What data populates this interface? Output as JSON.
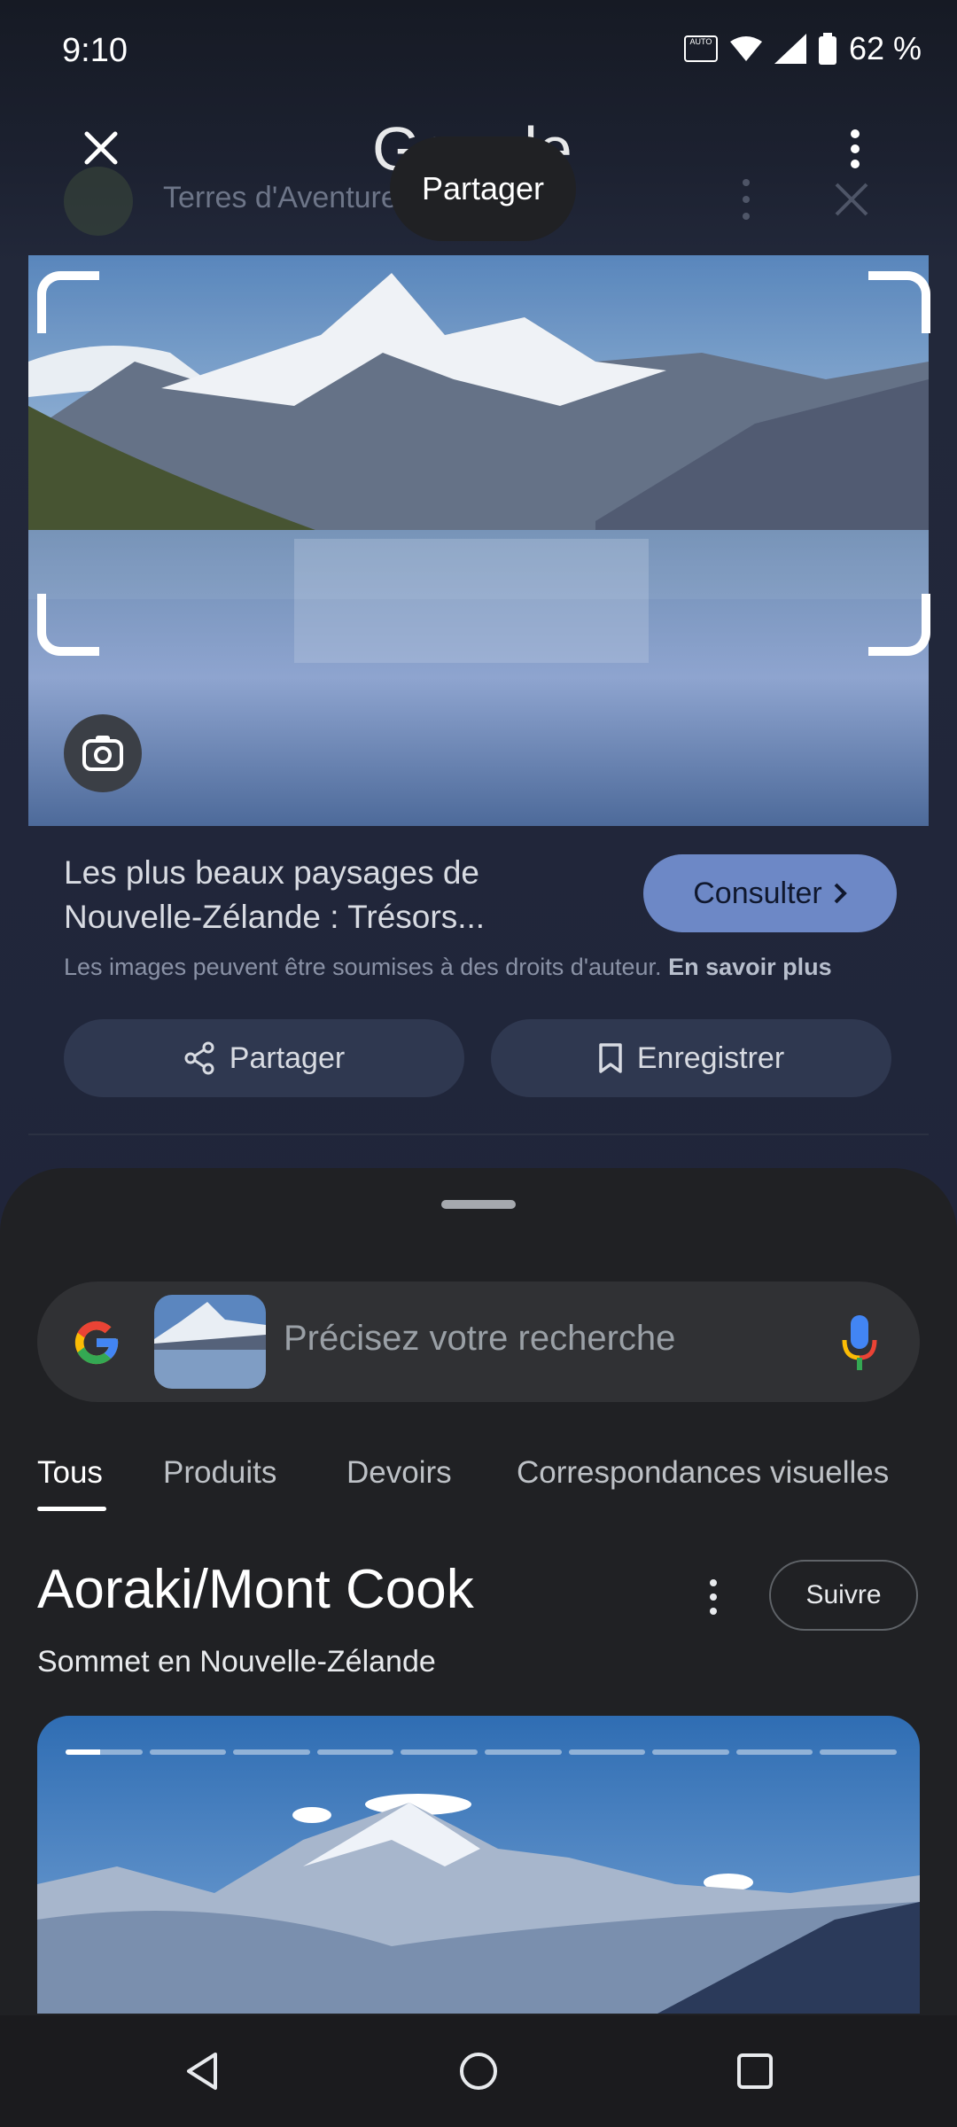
{
  "status_bar": {
    "time": "9:10",
    "auto_badge": "AUTO",
    "battery": "62 %"
  },
  "top_bar": {
    "logo_text": "Google"
  },
  "source": {
    "site_name": "Terres d'Aventure"
  },
  "tooltip": {
    "text": "Partager"
  },
  "result": {
    "title_line1": "Les plus beaux paysages de",
    "title_line2": "Nouvelle-Zélande : Trésors...",
    "consult_label": "Consulter",
    "copyright_text": "Les images peuvent être soumises à des droits d'auteur.",
    "learn_more": "En savoir plus",
    "share_label": "Partager",
    "save_label": "Enregistrer"
  },
  "search": {
    "placeholder": "Précisez votre recherche"
  },
  "tabs": [
    {
      "label": "Tous",
      "active": true
    },
    {
      "label": "Produits",
      "active": false
    },
    {
      "label": "Devoirs",
      "active": false
    },
    {
      "label": "Correspondances visuelles",
      "active": false
    }
  ],
  "knowledge_panel": {
    "title": "Aoraki/Mont Cook",
    "subtitle": "Sommet en Nouvelle-Zélande",
    "follow_label": "Suivre",
    "story_segments": 10,
    "story_progress_first_segment": 0.45
  },
  "colors": {
    "accent_button": "#6d88c6",
    "sheet_background": "#202124",
    "google_blue": "#4285F4",
    "google_red": "#EA4335",
    "google_yellow": "#FBBC05",
    "google_green": "#34A853"
  },
  "icons": {
    "close": "close-icon",
    "menu": "more-vert-icon",
    "lens": "lens-camera-icon",
    "share": "share-icon",
    "bookmark": "bookmark-icon",
    "mic": "mic-icon",
    "nav_back": "back-triangle-icon",
    "nav_home": "home-circle-icon",
    "nav_recents": "recents-square-icon"
  }
}
